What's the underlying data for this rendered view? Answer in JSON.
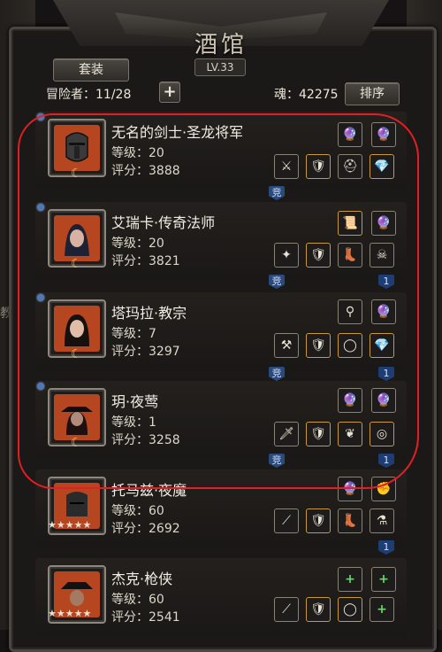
{
  "title": "酒馆",
  "level_badge": "LV.33",
  "set_button": "套装",
  "adventurers_label": "冒险者：11/28",
  "add_symbol": "+",
  "soul_label": "魂：42275",
  "sort_button": "排序",
  "side_text": "教",
  "heroes": [
    {
      "name": "无名的剑士·圣龙将军",
      "level": "等级：20",
      "score": "评分：3888",
      "tag_left": "竞",
      "tag_right": ""
    },
    {
      "name": "艾瑞卡·传奇法师",
      "level": "等级：20",
      "score": "评分：3821",
      "tag_left": "竞",
      "tag_right": "1"
    },
    {
      "name": "塔玛拉·教宗",
      "level": "等级：7",
      "score": "评分：3297",
      "tag_left": "竞",
      "tag_right": "1"
    },
    {
      "name": "玥·夜莺",
      "level": "等级：1",
      "score": "评分：3258",
      "tag_left": "竞",
      "tag_right": "1"
    },
    {
      "name": "托马兹·夜魔",
      "level": "等级：60",
      "score": "评分：2692",
      "tag_left": "",
      "tag_right": "1",
      "stars": "★★★★★"
    },
    {
      "name": "杰克·枪侠",
      "level": "等级：60",
      "score": "评分：2541",
      "tag_left": "",
      "tag_right": "",
      "stars": "★★★★★"
    }
  ],
  "colors": {
    "highlight_outline": "#e31e24",
    "accent_gold": "#c99a3d",
    "tag_blue": "#2b4a7c"
  }
}
